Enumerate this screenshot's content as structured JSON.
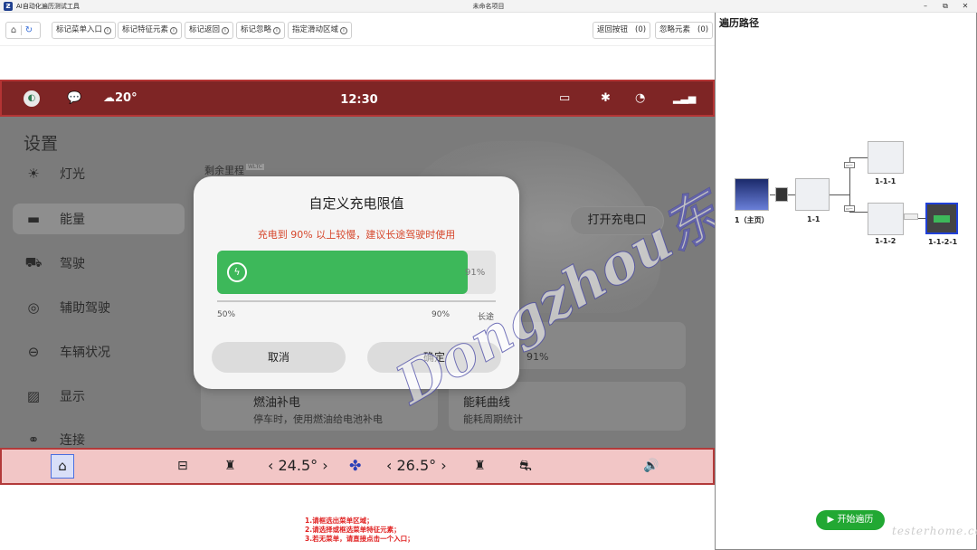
{
  "window": {
    "app_title": "AI自动化遍历测试工具",
    "title": "未命名项目",
    "min": "–",
    "max": "⧉",
    "close": "✕"
  },
  "toolbar": {
    "home_icon": "⌂",
    "refresh_icon": "↻",
    "buttons": [
      "标记菜单入口",
      "标记特征元素",
      "标记返回",
      "标记忽略",
      "指定滑动区域"
    ],
    "info": "i",
    "back_button": "返回按钮",
    "back_count": "(0)",
    "ignore_button": "忽略元素",
    "ignore_count": "(0)"
  },
  "status_bar": {
    "time": "12:30",
    "weather": "☁20°",
    "icons": [
      "app-icon",
      "message-icon",
      "weather-icon",
      "camera-icon",
      "bluetooth-icon",
      "wifi-icon",
      "signal-icon"
    ]
  },
  "settings": {
    "title": "设置",
    "nav": [
      {
        "label": "灯光",
        "icon": "☀"
      },
      {
        "label": "能量",
        "icon": "▬"
      },
      {
        "label": "驾驶",
        "icon": "⛟"
      },
      {
        "label": "辅助驾驶",
        "icon": "◎"
      },
      {
        "label": "车辆状况",
        "icon": "⊖"
      },
      {
        "label": "显示",
        "icon": "▨"
      },
      {
        "label": "连接",
        "icon": "⚭"
      }
    ],
    "range_label": "剩余里程",
    "range_badge": "WLTC",
    "open_charge_port": "打开充电口",
    "card1_title": "燃油补电",
    "card1_sub": "停车时，使用燃油给电池补电",
    "card2_title": "能耗曲线",
    "card2_sub": "能耗周期统计",
    "card_value": "91%"
  },
  "dialog": {
    "title": "自定义充电限值",
    "warning": "充电到 90% 以上较慢，建议长途驾驶时使用",
    "value_label": "91%",
    "value_fraction": 0.9,
    "ticks": [
      "50%",
      "90%",
      "长途"
    ],
    "cancel": "取消",
    "confirm": "确定"
  },
  "watermark": "Dongzhou东舟",
  "bottom_bar": {
    "temp_left": "24.5°",
    "temp_right": "26.5°",
    "left_arrow": "‹",
    "right_arrow": "›",
    "icons": [
      "home-icon",
      "defrost-icon",
      "seat-icon",
      "fan-icon",
      "seat-heat-icon",
      "car-icon",
      "volume-icon"
    ]
  },
  "instructions": [
    "1.请框选出菜单区域；",
    "2.请选择或框选菜单特征元素；",
    "3.若无菜单，请直接点击一个入口；"
  ],
  "panel": {
    "title": "遍历路径",
    "nodes": [
      "1（主页）",
      "1-1",
      "1-1-1",
      "1-1-2",
      "1-1-2-1"
    ],
    "start_button": "开始遍历",
    "start_icon": "▶",
    "credit": "testerhome.com"
  }
}
